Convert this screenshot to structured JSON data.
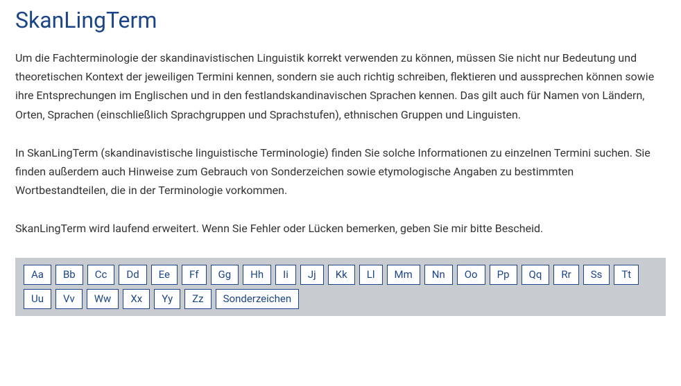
{
  "title": "SkanLingTerm",
  "paragraphs": [
    "Um die Fachterminologie der skandinavistischen Linguistik korrekt verwenden zu können, müssen Sie nicht nur Bedeutung und theoretischen Kontext der jeweiligen Termini kennen, sondern sie auch richtig schreiben, flektieren und aussprechen können sowie ihre Entsprechungen im Englischen und in den festlandskandinavischen Sprachen kennen. Das gilt auch für Namen von Ländern, Orten, Sprachen (einschließlich Sprachgruppen und Sprachstufen), ethnischen Gruppen und Linguisten.",
    "In SkanLingTerm (skandinavistische linguistische Terminologie) finden Sie solche Informationen zu einzelnen Termini suchen. Sie finden außerdem auch Hinweise zum Gebrauch von Sonderzeichen sowie etymologische Angaben zu bestimmten Wortbestandteilen, die in der Terminologie vorkommen.",
    "SkanLingTerm wird laufend erweitert. Wenn Sie Fehler oder Lücken bemerken, geben Sie mir bitte Bescheid."
  ],
  "index": [
    "Aa",
    "Bb",
    "Cc",
    "Dd",
    "Ee",
    "Ff",
    "Gg",
    "Hh",
    "Ii",
    "Jj",
    "Kk",
    "Ll",
    "Mm",
    "Nn",
    "Oo",
    "Pp",
    "Qq",
    "Rr",
    "Ss",
    "Tt",
    "Uu",
    "Vv",
    "Ww",
    "Xx",
    "Yy",
    "Zz",
    "Sonderzeichen"
  ]
}
